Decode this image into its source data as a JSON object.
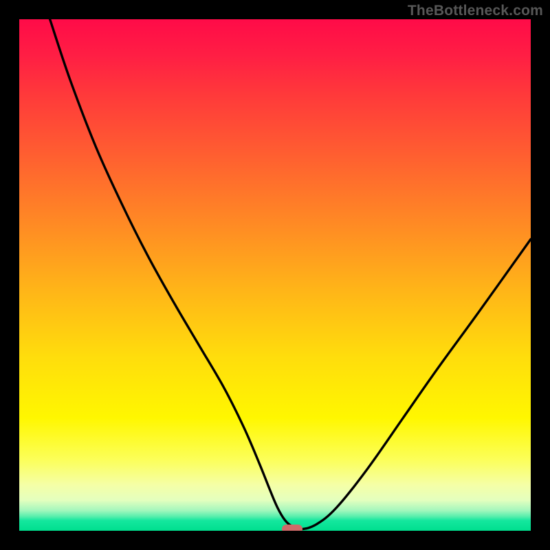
{
  "watermark": "TheBottleneck.com",
  "colors": {
    "frame_bg": "#000000",
    "curve_stroke": "#000000",
    "marker_fill": "#cf6a69",
    "watermark_text": "#575757",
    "gradient_stops": [
      "#ff0b48",
      "#ff1e44",
      "#ff3a3a",
      "#ff6030",
      "#ff8a24",
      "#ffb518",
      "#ffdd0c",
      "#fff700",
      "#fcff58",
      "#f5ffa6",
      "#e4ffbe",
      "#a4f7bd",
      "#58eead",
      "#14e79e",
      "#00df8e"
    ]
  },
  "chart_data": {
    "type": "line",
    "title": "",
    "xlabel": "",
    "ylabel": "",
    "xlim": [
      0,
      100
    ],
    "ylim": [
      0,
      100
    ],
    "grid": false,
    "series": [
      {
        "name": "bottleneck-curve",
        "x": [
          6,
          10,
          15,
          20,
          25,
          30,
          35,
          40,
          44,
          47,
          49,
          50.5,
          52,
          53.5,
          55,
          58,
          62,
          68,
          75,
          82,
          90,
          100
        ],
        "y": [
          100,
          88,
          75,
          64,
          54,
          45,
          36.5,
          28,
          20,
          13,
          8,
          4.5,
          2,
          0.8,
          0.3,
          1.2,
          4.5,
          12,
          22,
          32,
          43,
          57
        ]
      }
    ],
    "marker": {
      "x": 53.4,
      "y": 0.4
    },
    "annotations": []
  }
}
